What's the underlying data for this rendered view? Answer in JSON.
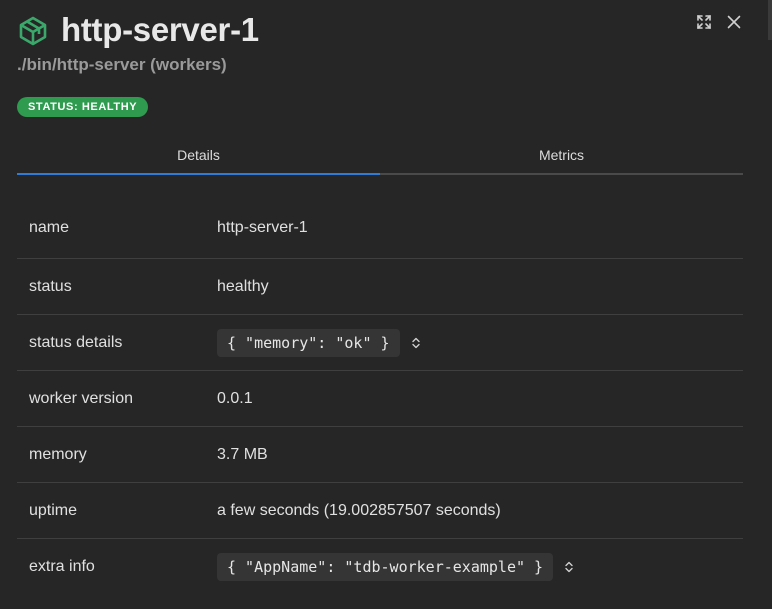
{
  "header": {
    "title": "http-server-1",
    "subtitle": "./bin/http-server (workers)",
    "logo_icon": "cube-outline-icon",
    "expand_icon": "expand-icon",
    "close_icon": "close-icon"
  },
  "status_badge": "STATUS: HEALTHY",
  "colors": {
    "background": "#262626",
    "badge_green": "#2e9b4f",
    "logo_green": "#3aa86b",
    "tab_active": "#2f7bd8"
  },
  "tabs": [
    {
      "label": "Details",
      "active": true
    },
    {
      "label": "Metrics",
      "active": false
    }
  ],
  "details": [
    {
      "key": "name",
      "value": "http-server-1"
    },
    {
      "key": "status",
      "value": "healthy"
    },
    {
      "key": "status details",
      "value": "{ \"memory\": \"ok\" }"
    },
    {
      "key": "worker version",
      "value": "0.0.1"
    },
    {
      "key": "memory",
      "value": "3.7 MB"
    },
    {
      "key": "uptime",
      "value": "a few seconds (19.002857507 seconds)"
    },
    {
      "key": "extra info",
      "value": "{ \"AppName\": \"tdb-worker-example\" }"
    }
  ]
}
